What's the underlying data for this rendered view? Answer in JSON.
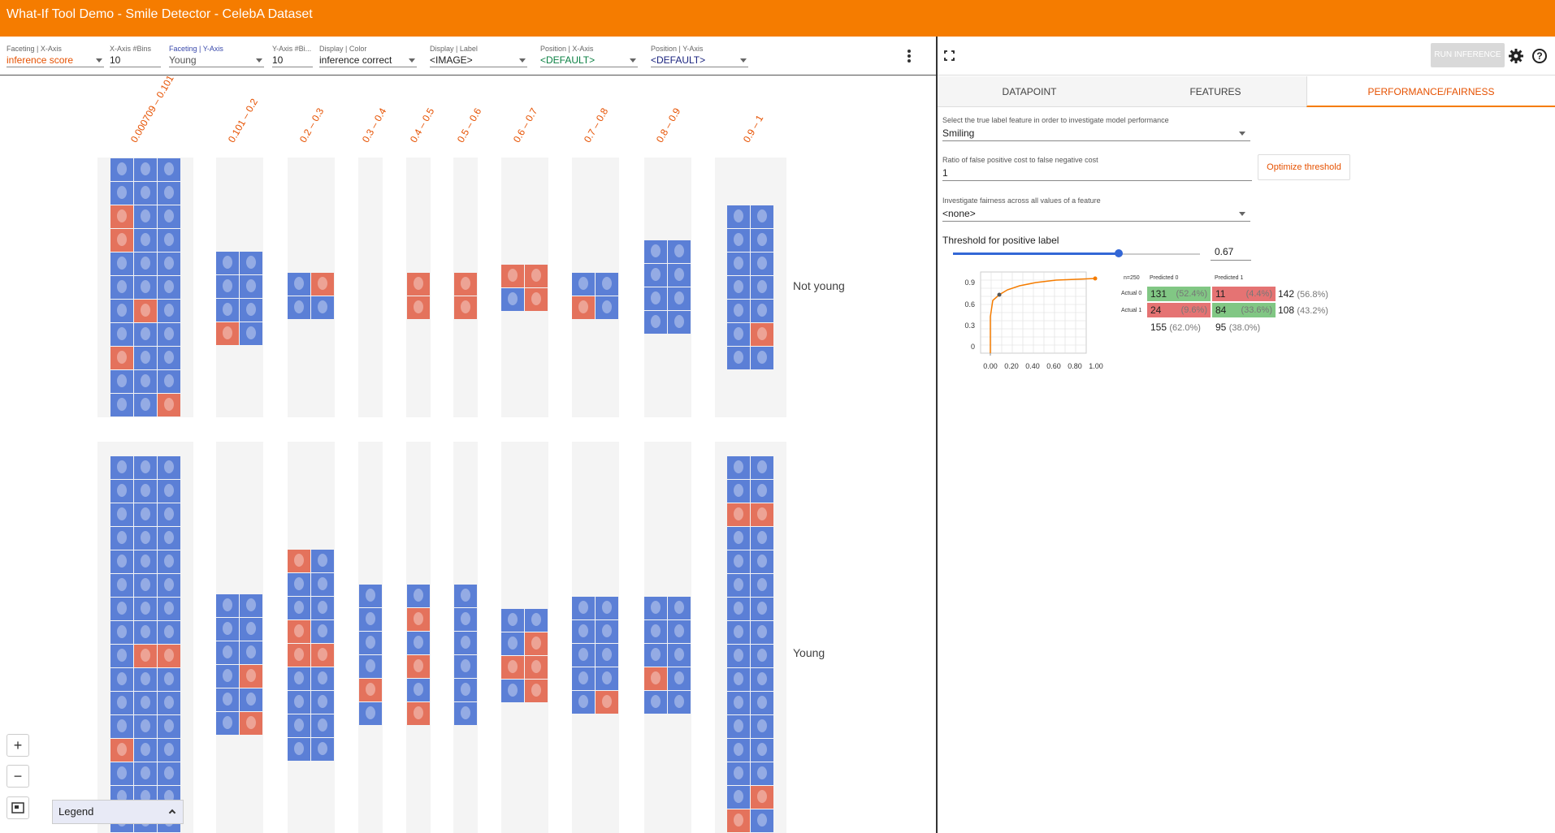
{
  "app": {
    "title": "What-If Tool Demo - Smile Detector - CelebA Dataset"
  },
  "controls": {
    "facet_x": {
      "label": "Faceting | X-Axis",
      "value": "inference score"
    },
    "x_bins": {
      "label": "X-Axis #Bins",
      "value": "10"
    },
    "facet_y": {
      "label": "Faceting | Y-Axis",
      "value": "Young"
    },
    "y_bins": {
      "label": "Y-Axis #Bi...",
      "value": "10"
    },
    "color": {
      "label": "Display | Color",
      "value": "inference correct"
    },
    "label": {
      "label": "Display | Label",
      "value": "<IMAGE>"
    },
    "pos_x": {
      "label": "Position | X-Axis",
      "value": "<DEFAULT>"
    },
    "pos_y": {
      "label": "Position | Y-Axis",
      "value": "<DEFAULT>"
    }
  },
  "grid": {
    "bins": [
      "0.000709 – 0.101",
      "0.101 – 0.2",
      "0.2 – 0.3",
      "0.3 – 0.4",
      "0.4 – 0.5",
      "0.5 – 0.6",
      "0.6 – 0.7",
      "0.7 – 0.8",
      "0.8 – 0.9",
      "0.9 – 1"
    ],
    "rows": [
      "Not young",
      "Young"
    ],
    "colors": {
      "correct": "#5b7fd6",
      "incorrect": "#e4725c"
    },
    "legend_label": "Legend"
  },
  "right_panel": {
    "run_label": "RUN INFERENCE",
    "tabs": [
      "DATAPOINT",
      "FEATURES",
      "PERFORMANCE/FAIRNESS"
    ],
    "true_label": {
      "label": "Select the true label feature in order to investigate model performance",
      "value": "Smiling"
    },
    "cost_ratio": {
      "label": "Ratio of false positive cost to false negative cost",
      "value": "1"
    },
    "optimize_label": "Optimize threshold",
    "fairness": {
      "label": "Investigate fairness across all values of a feature",
      "value": "<none>"
    },
    "threshold": {
      "label": "Threshold for positive label",
      "value": "0.67",
      "fraction": 0.67
    },
    "roc": {
      "y_ticks": [
        "0.9",
        "0.6",
        "0.3",
        "0"
      ],
      "x_ticks": [
        "0.00",
        "0.20",
        "0.40",
        "0.60",
        "0.80",
        "1.00"
      ]
    },
    "confusion": {
      "n": "n=250",
      "pred0": "Predicted 0",
      "pred1": "Predicted 1",
      "act0": "Actual 0",
      "act1": "Actual 1",
      "tn": "131",
      "tn_pct": "(52.4%)",
      "fp": "11",
      "fp_pct": "(4.4%)",
      "fn": "24",
      "fn_pct": "(9.6%)",
      "tp": "84",
      "tp_pct": "(33.6%)",
      "row0_total": "142",
      "row0_pct": "(56.8%)",
      "row1_total": "108",
      "row1_pct": "(43.2%)",
      "col0_total": "155",
      "col0_pct": "(62.0%)",
      "col1_total": "95",
      "col1_pct": "(38.0%)"
    }
  }
}
